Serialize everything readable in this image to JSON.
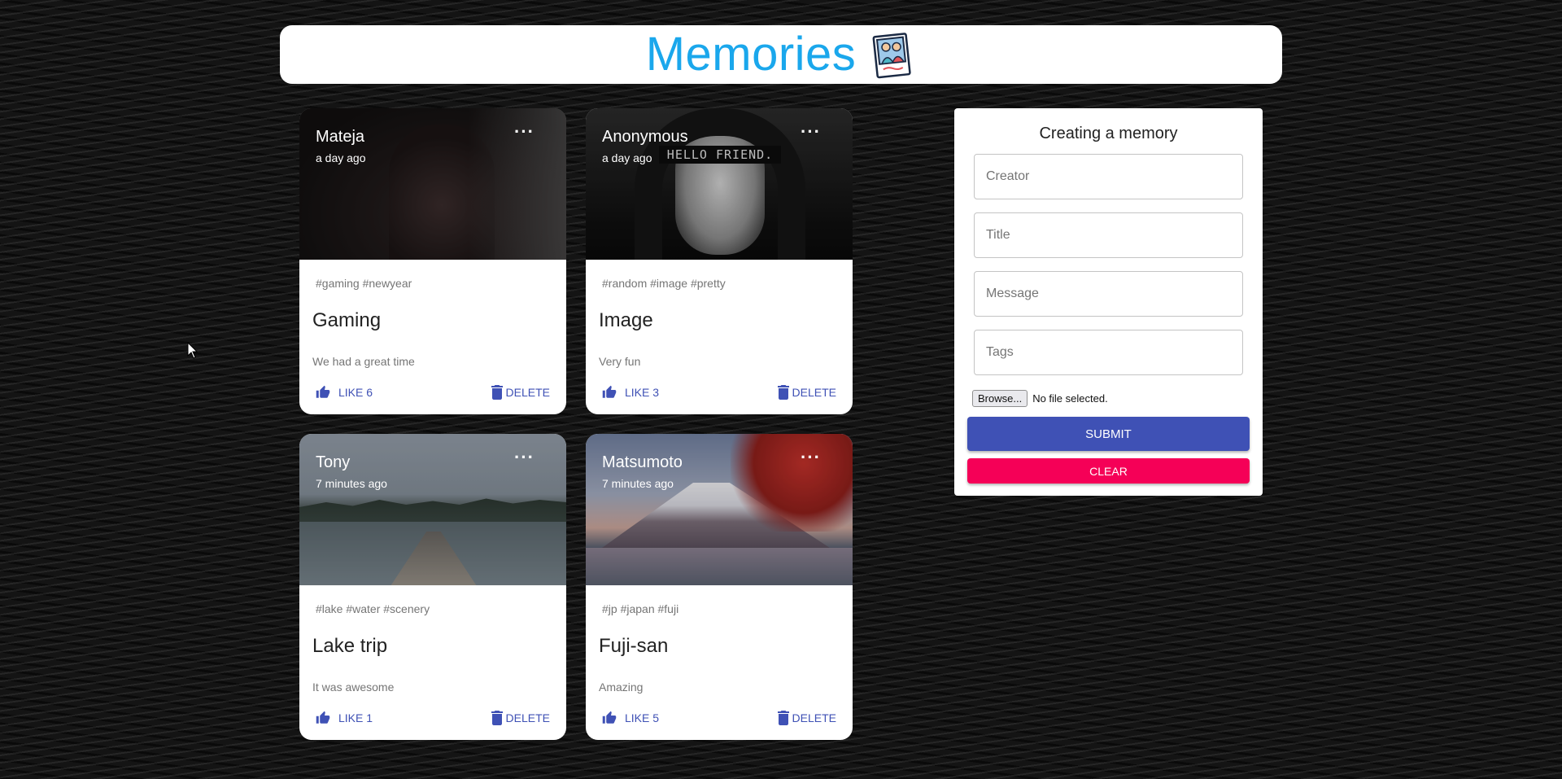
{
  "header": {
    "title": "Memories",
    "logo_icon": "memories-photos-icon"
  },
  "posts": [
    {
      "creator": "Mateja",
      "time": "a day ago",
      "tags": "#gaming #newyear",
      "title": "Gaming",
      "message": "We had a great time",
      "like_label": "LIKE 6",
      "delete_label": "DELETE",
      "image": "hooded-person-photo"
    },
    {
      "creator": "Anonymous",
      "time": "a day ago",
      "tags": "#random #image #pretty",
      "title": "Image",
      "message": "Very fun",
      "like_label": "LIKE 3",
      "delete_label": "DELETE",
      "image": "hello-friend-hoodie-photo",
      "image_text": "HELLO FRIEND."
    },
    {
      "creator": "Tony",
      "time": "7 minutes ago",
      "tags": "#lake #water #scenery",
      "title": "Lake trip",
      "message": "It was awesome",
      "like_label": "LIKE 1",
      "delete_label": "DELETE",
      "image": "lake-pier-photo"
    },
    {
      "creator": "Matsumoto",
      "time": "7 minutes ago",
      "tags": "#jp #japan #fuji",
      "title": "Fuji-san",
      "message": "Amazing",
      "like_label": "LIKE 5",
      "delete_label": "DELETE",
      "image": "mount-fuji-photo"
    }
  ],
  "form": {
    "title": "Creating a memory",
    "creator_placeholder": "Creator",
    "title_placeholder": "Title",
    "message_placeholder": "Message",
    "tags_placeholder": "Tags",
    "browse_label": "Browse...",
    "file_status": "No file selected.",
    "submit_label": "SUBMIT",
    "clear_label": "CLEAR"
  },
  "colors": {
    "accent": "#3f51b5",
    "secondary": "#f50057",
    "title": "#1aa7ec"
  }
}
